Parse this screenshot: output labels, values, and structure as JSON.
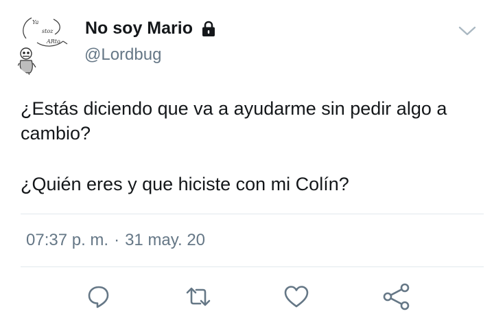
{
  "user": {
    "display_name": "No soy Mario",
    "username": "@Lordbug",
    "avatar_bubble_texts": [
      "Ya",
      "stoz",
      "ARto"
    ]
  },
  "tweet": {
    "paragraphs": [
      "¿Estás diciendo que va a ayudarme sin pedir algo a cambio?",
      "¿Quién eres y que hiciste con mi Colín?"
    ],
    "time": "07:37 p. m.",
    "separator": "·",
    "date": "31 may. 20"
  },
  "icons": {
    "protected": "lock-icon",
    "menu": "chevron-down-icon",
    "reply": "comment-icon",
    "retweet": "retweet-icon",
    "like": "heart-icon",
    "share": "share-icon"
  },
  "colors": {
    "text": "#14171a",
    "secondary": "#657786",
    "divider": "#e1e8ed",
    "icon": "#657786"
  }
}
